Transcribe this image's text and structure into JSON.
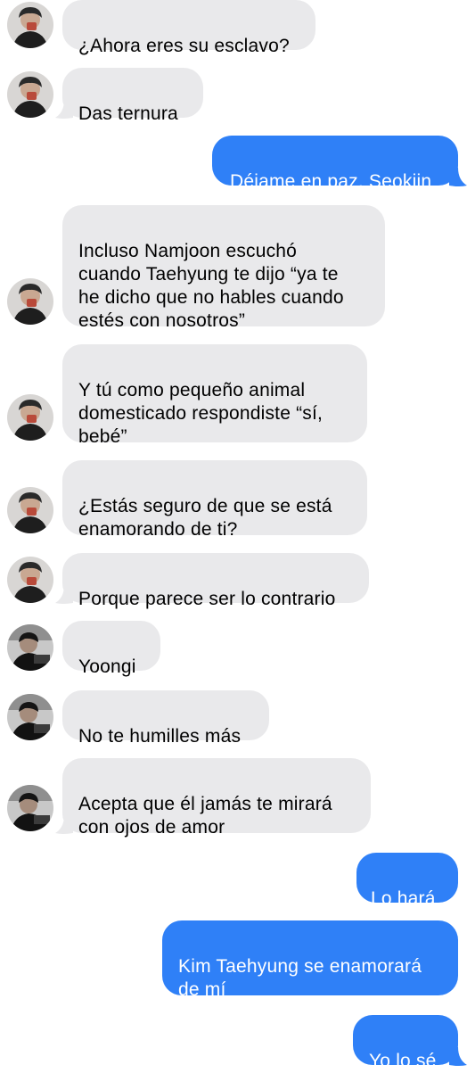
{
  "colors": {
    "incoming_bubble": "#e9e9eb",
    "outgoing_bubble": "#2f80f7",
    "outgoing_text": "#ffffff",
    "incoming_text": "#000000"
  },
  "messages": [
    {
      "direction": "incoming",
      "sender": "seokjin",
      "text": "¿Ahora eres su esclavo?"
    },
    {
      "direction": "incoming",
      "sender": "seokjin",
      "text": "Das ternura"
    },
    {
      "direction": "outgoing",
      "text": "Déjame en paz, Seokjin"
    },
    {
      "direction": "incoming",
      "sender": "seokjin",
      "text": "Incluso Namjoon escuchó\ncuando Taehyung te dijo “ya te\nhe dicho que no hables cuando\nestés con nosotros”"
    },
    {
      "direction": "incoming",
      "sender": "seokjin",
      "text": "Y tú como pequeño animal\ndomesticado respondiste “sí,\nbebé”"
    },
    {
      "direction": "incoming",
      "sender": "seokjin",
      "text": "¿Estás seguro de que se está\nenamorando de ti?"
    },
    {
      "direction": "incoming",
      "sender": "seokjin",
      "text": "Porque parece ser lo contrario"
    },
    {
      "direction": "incoming",
      "sender": "yoongi",
      "text": "Yoongi"
    },
    {
      "direction": "incoming",
      "sender": "yoongi",
      "text": "No te humilles más"
    },
    {
      "direction": "incoming",
      "sender": "yoongi",
      "text": "Acepta que él jamás te mirará\ncon ojos de amor"
    },
    {
      "direction": "outgoing",
      "text": "Lo hará"
    },
    {
      "direction": "outgoing",
      "text": "Kim Taehyung se enamorará\nde mí"
    },
    {
      "direction": "outgoing",
      "text": "Yo lo sé"
    }
  ]
}
